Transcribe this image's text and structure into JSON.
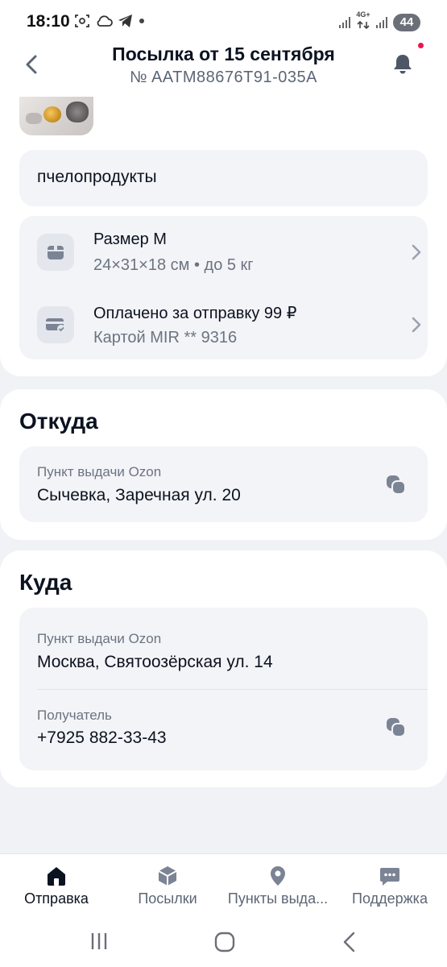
{
  "status_bar": {
    "time": "18:10",
    "network": "4G+",
    "battery": "44"
  },
  "header": {
    "title": "Посылка от 15 сентября",
    "subtitle": "№ AATM88676T91-035A"
  },
  "parcel": {
    "description": "пчелопродукты",
    "size": {
      "title": "Размер M",
      "details": "24×31×18 см • до 5 кг"
    },
    "payment": {
      "title": "Оплачено за отправку 99 ₽",
      "details": "Картой MIR ** 9316"
    }
  },
  "from": {
    "title": "Откуда",
    "label": "Пункт выдачи Ozon",
    "address": "Сычевка, Заречная ул. 20"
  },
  "to": {
    "title": "Куда",
    "label": "Пункт выдачи Ozon",
    "address": "Москва, Святоозёрская ул. 14",
    "recipient_label": "Получатель",
    "recipient_phone": "+7925 882-33-43"
  },
  "bottom_nav": {
    "items": [
      {
        "label": "Отправка",
        "icon": "home-icon",
        "active": true
      },
      {
        "label": "Посылки",
        "icon": "parcel-icon",
        "active": false
      },
      {
        "label": "Пункты выда...",
        "icon": "location-pin-icon",
        "active": false
      },
      {
        "label": "Поддержка",
        "icon": "chat-icon",
        "active": false
      }
    ]
  },
  "colors": {
    "accent_dot": "#e5194e",
    "background": "#f1f2f6",
    "card": "#ffffff",
    "block": "#f3f4f7",
    "text_primary": "#0b1220",
    "text_secondary": "#6b7482"
  }
}
